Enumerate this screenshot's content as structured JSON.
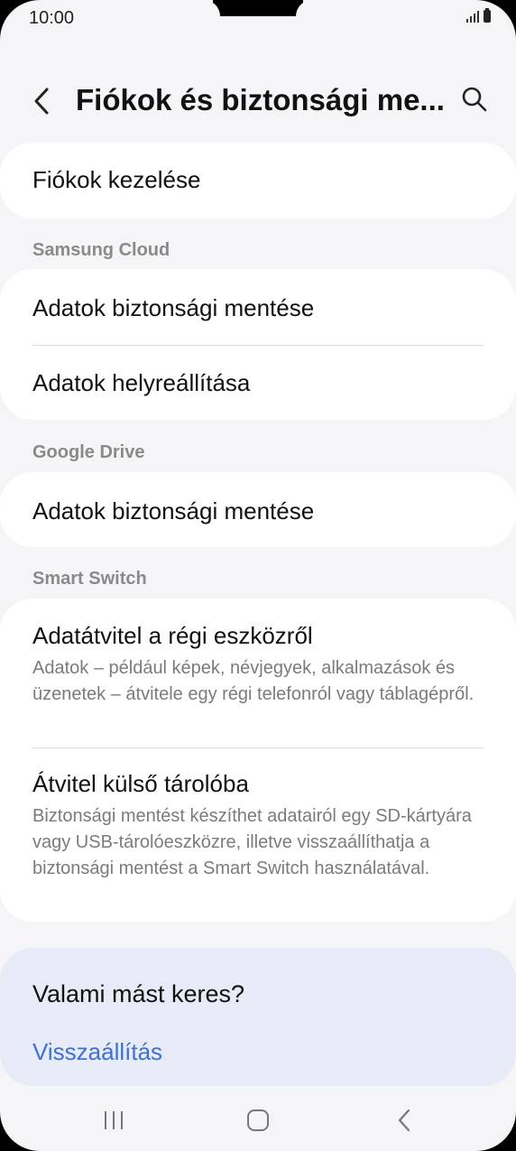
{
  "status_bar": {
    "time": "10:00"
  },
  "app_bar": {
    "title": "Fiókok és biztonsági me..."
  },
  "accounts": {
    "manage_label": "Fiókok kezelése"
  },
  "samsung_cloud": {
    "header": "Samsung Cloud",
    "backup_label": "Adatok biztonsági mentése",
    "restore_label": "Adatok helyreállítása"
  },
  "google_drive": {
    "header": "Google Drive",
    "backup_label": "Adatok biztonsági mentése"
  },
  "smart_switch": {
    "header": "Smart Switch",
    "transfer_title": "Adatátvitel a régi eszközről",
    "transfer_desc": "Adatok – például képek, névjegyek, alkalmazások és üzenetek – átvitele egy régi telefonról vagy táblagépről.",
    "external_title": "Átvitel külső tárolóba",
    "external_desc": "Biztonsági mentést készíthet adatairól egy SD-kártyára vagy USB-tárolóeszközre, illetve visszaállíthatja a biztonsági mentést a Smart Switch használatával."
  },
  "suggestion": {
    "question": "Valami mást keres?",
    "link": "Visszaállítás"
  },
  "icons": {
    "back": "back-arrow-icon",
    "search": "search-icon",
    "nav_recents": "recents-icon",
    "nav_home": "home-icon",
    "nav_back": "back-icon"
  },
  "colors": {
    "link": "#3e71d1",
    "suggestion_bg": "#e7ebf7"
  }
}
